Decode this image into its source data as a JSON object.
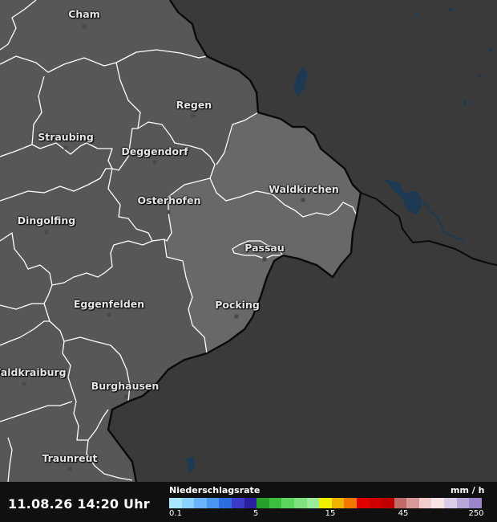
{
  "timestamp": "11.08.26 14:20 Uhr",
  "legend": {
    "title": "Niederschlagsrate",
    "unit": "mm / h",
    "ticks": [
      "0.1",
      "5",
      "15",
      "45",
      "250"
    ],
    "colors": [
      "#a8e6ff",
      "#8cd2ff",
      "#6ab4ff",
      "#4a96f0",
      "#2a6ee0",
      "#3a3cc8",
      "#2a20a0",
      "#27a12a",
      "#3cbf3c",
      "#5cd65c",
      "#7ee07e",
      "#9ceb9c",
      "#f0f000",
      "#f0b400",
      "#f07800",
      "#e00000",
      "#d00000",
      "#c00000",
      "#c06a6a",
      "#d89898",
      "#f0cccc",
      "#f8e4e4",
      "#d8cce8",
      "#b8a8d8",
      "#9c84c8"
    ]
  },
  "cities": [
    {
      "name": "Cham"
    },
    {
      "name": "Regen"
    },
    {
      "name": "Straubing"
    },
    {
      "name": "Deggendorf"
    },
    {
      "name": "Osterhofen"
    },
    {
      "name": "Waldkirchen"
    },
    {
      "name": "Dingolfing"
    },
    {
      "name": "Passau"
    },
    {
      "name": "Eggenfelden"
    },
    {
      "name": "Pocking"
    },
    {
      "name": "Waldkraiburg"
    },
    {
      "name": "Burghausen"
    },
    {
      "name": "Traunreut"
    }
  ],
  "colors": {
    "foreign_area": "#3a3a3a",
    "region_fill": "#575757",
    "highlight_fill": "#6a6a6a",
    "district_border": "#ffffff",
    "national_border": "#0a0a0a",
    "water": "#1d3a52"
  }
}
